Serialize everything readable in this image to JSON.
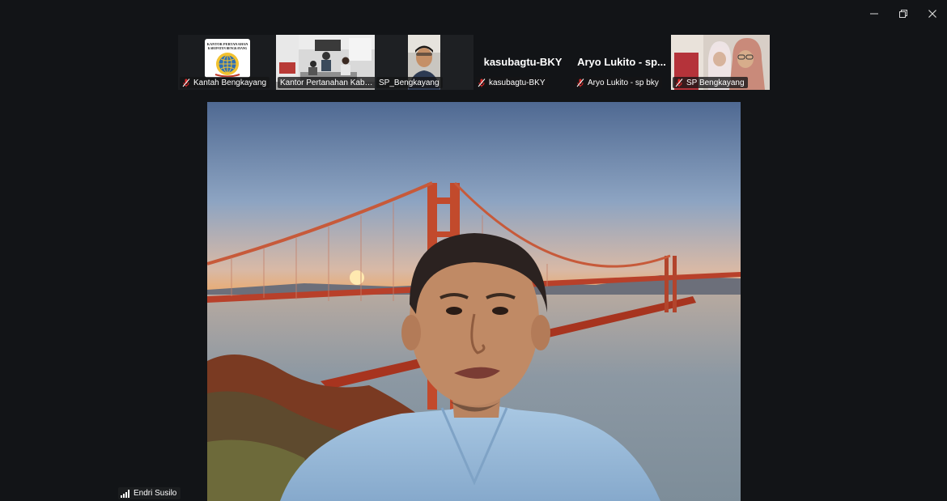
{
  "window": {
    "minimize_icon": "minimize-icon",
    "restore_icon": "restore-icon",
    "close_icon": "close-icon"
  },
  "gallery": {
    "tiles": [
      {
        "label": "Kantah Bengkayang",
        "muted": true,
        "content": "logo"
      },
      {
        "label": "Kantor Pertanahan Kabup...",
        "muted": false,
        "content": "video"
      },
      {
        "label": "SP_Bengkayang",
        "muted": false,
        "content": "video"
      },
      {
        "label": "kasubagtu-BKY",
        "display_name": "kasubagtu-BKY",
        "muted": true,
        "content": "name"
      },
      {
        "label": "Aryo Lukito - sp bky",
        "display_name": "Aryo Lukito - sp...",
        "muted": true,
        "content": "name"
      },
      {
        "label": "SP Bengkayang",
        "muted": true,
        "content": "video"
      }
    ]
  },
  "logo_text": {
    "line1": "KANTOR PERTANAHAN",
    "line2": "KABUPATEN BENGKAYANG"
  },
  "speaker": {
    "name": "Endri Susilo",
    "signal_icon": "signal-bars-icon"
  },
  "colors": {
    "background": "#121417",
    "mic_off": "#e02828",
    "label_bg": "#1c1e21"
  }
}
